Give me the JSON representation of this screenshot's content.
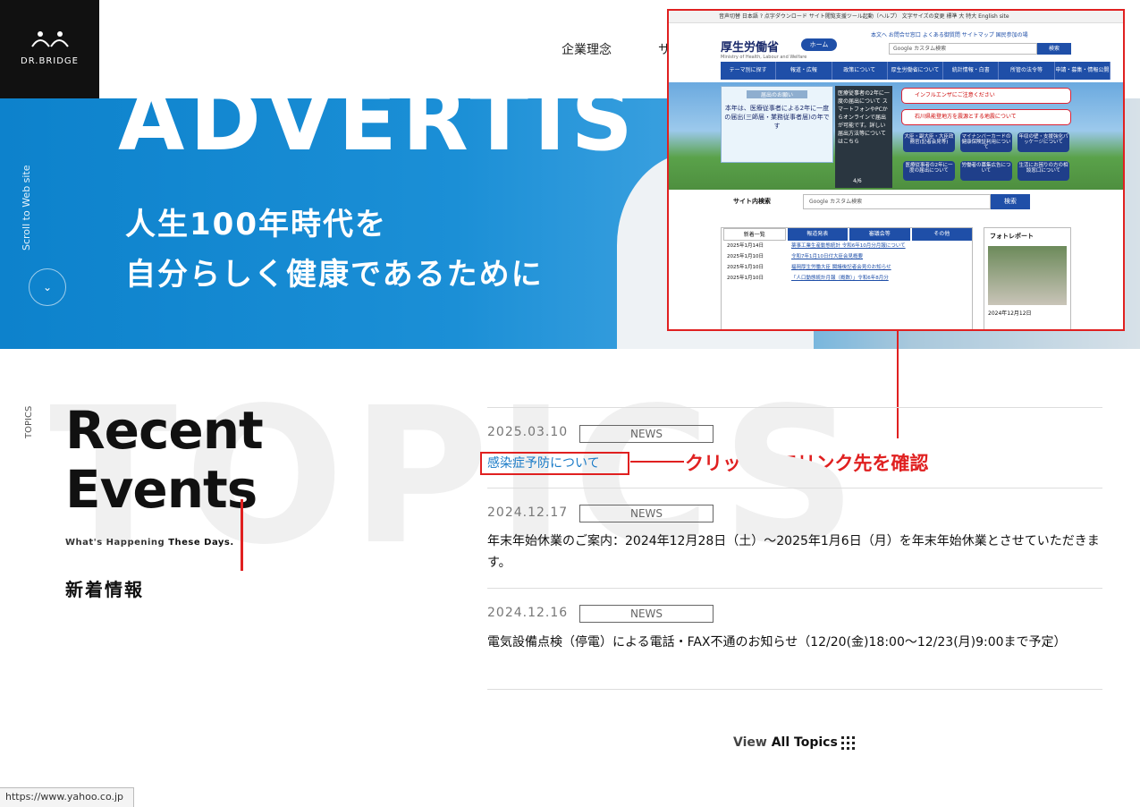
{
  "header": {
    "logo_text": "DR.BRIDGE",
    "nav": [
      "企業理念",
      "サ"
    ]
  },
  "hero": {
    "big_word": "ADVERTIS",
    "line1": "人生100年時代を",
    "line2": "自分らしく健康であるために",
    "scroll_label": "Scroll to Web site",
    "scroll_icon": "chevron-down-icon"
  },
  "overlay": {
    "top_bar": "音声切替  日本語  ?   点字ダウンロード  サイト閲覧支援ツール起動（ヘルプ）  文字サイズの変更 標準 大 特大  English site",
    "brand": "厚生労働省",
    "brand_en": "Ministry of Health, Labour and Welfare",
    "home": "ホーム",
    "links": "本文へ    お問合せ窓口    よくある御質問    サイトマップ    国民参加の場",
    "search_placeholder": "Google カスタム検索",
    "search_btn": "検索",
    "gnav": [
      "テーマ別に探す",
      "報道・広報",
      "政策について",
      "厚生労働省について",
      "統計情報・白書",
      "所管の法令等",
      "申請・募集・情報公開"
    ],
    "banner_head": "届出のお願い",
    "banner_text": "本年は、医療従事者による2年に一度の届出(三師届・業務従事者届)の年です",
    "banner_side": "医療従事者の2年に一度の届出について スマートフォンやPCからオンラインで届出が可能です。詳しい届出方法等についてはこちら",
    "banner_page": "4/6",
    "alert1": "インフルエンザにご注意ください",
    "alert2": "石川県能登地方を震源とする地震について",
    "tiles": [
      "大臣・副大臣・大臣政務官(記者会見等)",
      "マイナンバーカードの健康保険証利用について",
      "年収の壁・支援強化パッケージについて",
      "医療従事者の2年に一度の届出について",
      "労働者の募集広告について",
      "生活にお困りの方の相談窓口について"
    ],
    "site_search_label": "サイト内検索",
    "site_search_placeholder": "Google カスタム検索",
    "site_search_btn": "検索",
    "tabs": [
      "新着一覧",
      "報道発表",
      "審議会等",
      "その他"
    ],
    "news": [
      {
        "date": "2025年1月14日",
        "title": "薬事工業生産動態統計 令和6年10月分月報について"
      },
      {
        "date": "2025年1月10日",
        "title": "令和7年1月10日付大臣会見概要"
      },
      {
        "date": "2025年1月10日",
        "title": "福岡厚生労働大臣 閣議後記者会見のお知らせ"
      },
      {
        "date": "2025年1月10日",
        "title": "「人口動態統計月報（概数）」令和6年8月分"
      }
    ],
    "photo_head": "フォトレポート",
    "photo_date": "2024年12月12日"
  },
  "annotation": "クリックしてリンク先を確認",
  "topics": {
    "bg_word": "TOPICS",
    "side_label": "TOPICS",
    "heading1": "Recent",
    "heading2": "Events",
    "sub_a": "What's Happening",
    "sub_b": "These Days.",
    "jp": "新着情報",
    "items": [
      {
        "date": "2025.03.10",
        "tag": "NEWS",
        "title": "感染症予防について"
      },
      {
        "date": "2024.12.17",
        "tag": "NEWS",
        "title": "年末年始休業のご案内：2024年12月28日（土）～2025年1月6日（月）を年末年始休業とさせていただきます。"
      },
      {
        "date": "2024.12.16",
        "tag": "NEWS",
        "title": "電気設備点検（停電）による電話・FAX不通のお知らせ（12/20(金)18:00～12/23(月)9:00まで予定）"
      }
    ],
    "view_all_a": "View",
    "view_all_b": "All Topics"
  },
  "status_url": "https://www.yahoo.co.jp",
  "colors": {
    "accent": "#e02020",
    "hero_blue": "#1b8fd6",
    "link": "#1a7bc7",
    "mhlw_blue": "#1f4fa8"
  }
}
